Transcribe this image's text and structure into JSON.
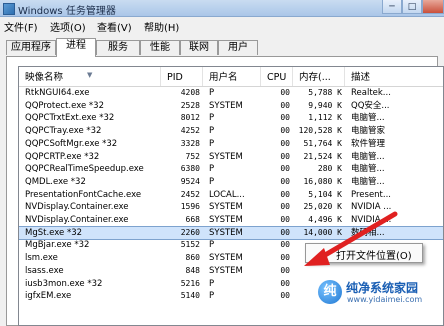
{
  "window": {
    "title": "Windows 任务管理器"
  },
  "window_buttons": {
    "minimize": "─",
    "restore": "□"
  },
  "menu": [
    "文件(F)",
    "选项(O)",
    "查看(V)",
    "帮助(H)"
  ],
  "tabs": [
    "应用程序",
    "进程",
    "服务",
    "性能",
    "联网",
    "用户"
  ],
  "active_tab": "进程",
  "columns": [
    "映像名称",
    "PID",
    "用户名",
    "CPU",
    "内存(...",
    "描述"
  ],
  "rows": [
    [
      "RtkNGUI64.exe",
      "4208",
      "P",
      "00",
      "5,788 K",
      "Realtek..."
    ],
    [
      "QQProtect.exe *32",
      "2528",
      "SYSTEM",
      "00",
      "9,940 K",
      "QQ安全..."
    ],
    [
      "QQPCTrxtExt.exe *32",
      "8012",
      "P",
      "00",
      "1,112 K",
      "电脑管..."
    ],
    [
      "QQPCTray.exe *32",
      "4252",
      "P",
      "00",
      "120,528 K",
      "电脑管家"
    ],
    [
      "QQPCSoftMgr.exe *32",
      "3328",
      "P",
      "00",
      "51,764 K",
      "软件管理"
    ],
    [
      "QQPCRTP.exe *32",
      "752",
      "SYSTEM",
      "00",
      "21,524 K",
      "电脑管..."
    ],
    [
      "QQPCRealTimeSpeedup.exe",
      "6380",
      "P",
      "00",
      "280 K",
      "电脑管..."
    ],
    [
      "QMDL.exe *32",
      "9524",
      "P",
      "00",
      "16,080 K",
      "电脑管..."
    ],
    [
      "PresentationFontCache.exe",
      "2452",
      "LOCAL...",
      "00",
      "5,104 K",
      "Present..."
    ],
    [
      "NVDisplay.Container.exe",
      "1596",
      "SYSTEM",
      "00",
      "25,020 K",
      "NVIDIA ..."
    ],
    [
      "NVDisplay.Container.exe",
      "668",
      "SYSTEM",
      "00",
      "4,496 K",
      "NVIDIA ..."
    ],
    [
      "MgSt.exe *32",
      "2260",
      "SYSTEM",
      "00",
      "14,000 K",
      "数码相..."
    ],
    [
      "MgBjar.exe *32",
      "5152",
      "P",
      "00",
      "",
      ""
    ],
    [
      "lsm.exe",
      "860",
      "SYSTEM",
      "00",
      "",
      ""
    ],
    [
      "lsass.exe",
      "848",
      "SYSTEM",
      "00",
      "",
      ""
    ],
    [
      "iusb3mon.exe *32",
      "5216",
      "P",
      "00",
      "",
      ""
    ],
    [
      "igfxEM.exe",
      "5140",
      "P",
      "00",
      "",
      ""
    ]
  ],
  "selected_row": "MgSt.exe *32",
  "context_menu": {
    "label": "打开文件位置(O)"
  },
  "watermark": {
    "logo": "纯",
    "title": "纯净系统家园",
    "url": "www.yidaimei.com"
  },
  "colors": {
    "selection": "#cfe3fb",
    "arrow": "#e02020",
    "watermark": "#1a5fb4"
  }
}
